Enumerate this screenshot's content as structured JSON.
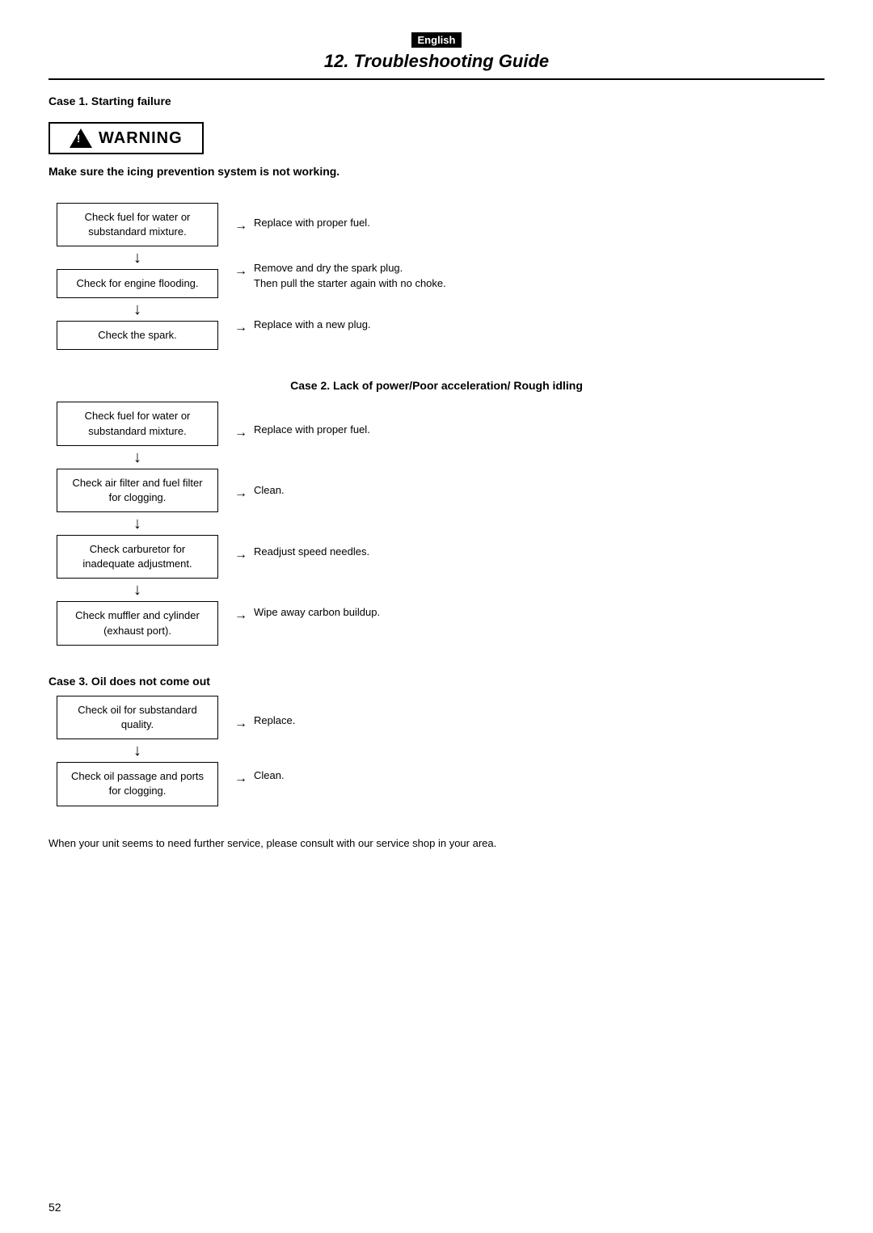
{
  "language_badge": "English",
  "section_title": "12. Troubleshooting Guide",
  "warning": {
    "label": "WARNING",
    "subtitle": "Make sure the icing prevention system is not working."
  },
  "case1": {
    "heading": "Case 1. Starting failure",
    "steps": [
      {
        "check": "Check fuel for water or substandard mixture.",
        "action": "Replace with proper fuel."
      },
      {
        "check": "Check for engine flooding.",
        "action": "Remove and dry the spark plug.\nThen pull the starter again with no choke."
      },
      {
        "check": "Check the spark.",
        "action": "Replace with a new plug."
      }
    ]
  },
  "case2": {
    "heading": "Case 2. Lack of power/Poor acceleration/ Rough idling",
    "steps": [
      {
        "check": "Check fuel for water or substandard mixture.",
        "action": "Replace with proper fuel."
      },
      {
        "check": "Check air filter and fuel filter for clogging.",
        "action": "Clean."
      },
      {
        "check": "Check carburetor for inadequate adjustment.",
        "action": "Readjust speed needles."
      },
      {
        "check": "Check muffler and cylinder (exhaust port).",
        "action": "Wipe away carbon buildup."
      }
    ]
  },
  "case3": {
    "heading": "Case 3. Oil does not come out",
    "steps": [
      {
        "check": "Check oil for substandard quality.",
        "action": "Replace."
      },
      {
        "check": "Check oil passage and ports for clogging.",
        "action": "Clean."
      }
    ]
  },
  "footer_note": "When your unit seems to need further service, please consult with our service shop in your area.",
  "page_number": "52"
}
